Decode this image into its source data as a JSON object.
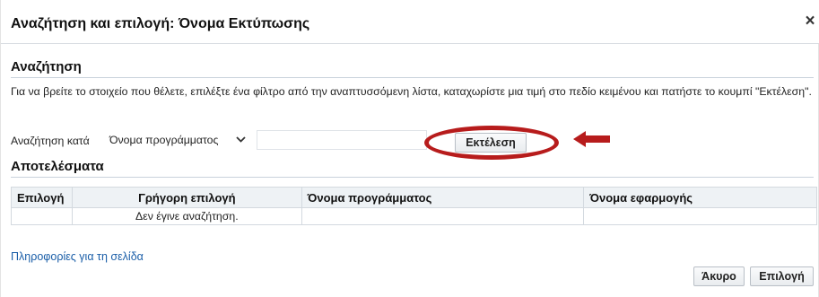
{
  "dialog": {
    "title": "Αναζήτηση και επιλογή: Όνομα Εκτύπωσης",
    "close_symbol": "×"
  },
  "search": {
    "heading": "Αναζήτηση",
    "instructions": "Για να βρείτε το στοιχείο που θέλετε, επιλέξτε ένα φίλτρο από την αναπτυσσόμενη λίστα, καταχωρίστε μια τιμή στο πεδίο κειμένου και πατήστε το κουμπί \"Εκτέλεση\".",
    "by_label": "Αναζήτηση κατά",
    "filter_selected": "Όνομα προγράμματος",
    "text_value": "",
    "go_button": "Εκτέλεση",
    "highlight_color": "#b71c1c"
  },
  "results": {
    "heading": "Αποτελέσματα",
    "columns": [
      "Επιλογή",
      "Γρήγορη επιλογή",
      "Όνομα προγράμματος",
      "Όνομα εφαρμογής"
    ],
    "empty_message": "Δεν έγινε αναζήτηση."
  },
  "footer": {
    "page_info_link": "Πληροφορίες για τη σελίδα",
    "cancel_button": "Άκυρο",
    "select_button": "Επιλογή"
  }
}
